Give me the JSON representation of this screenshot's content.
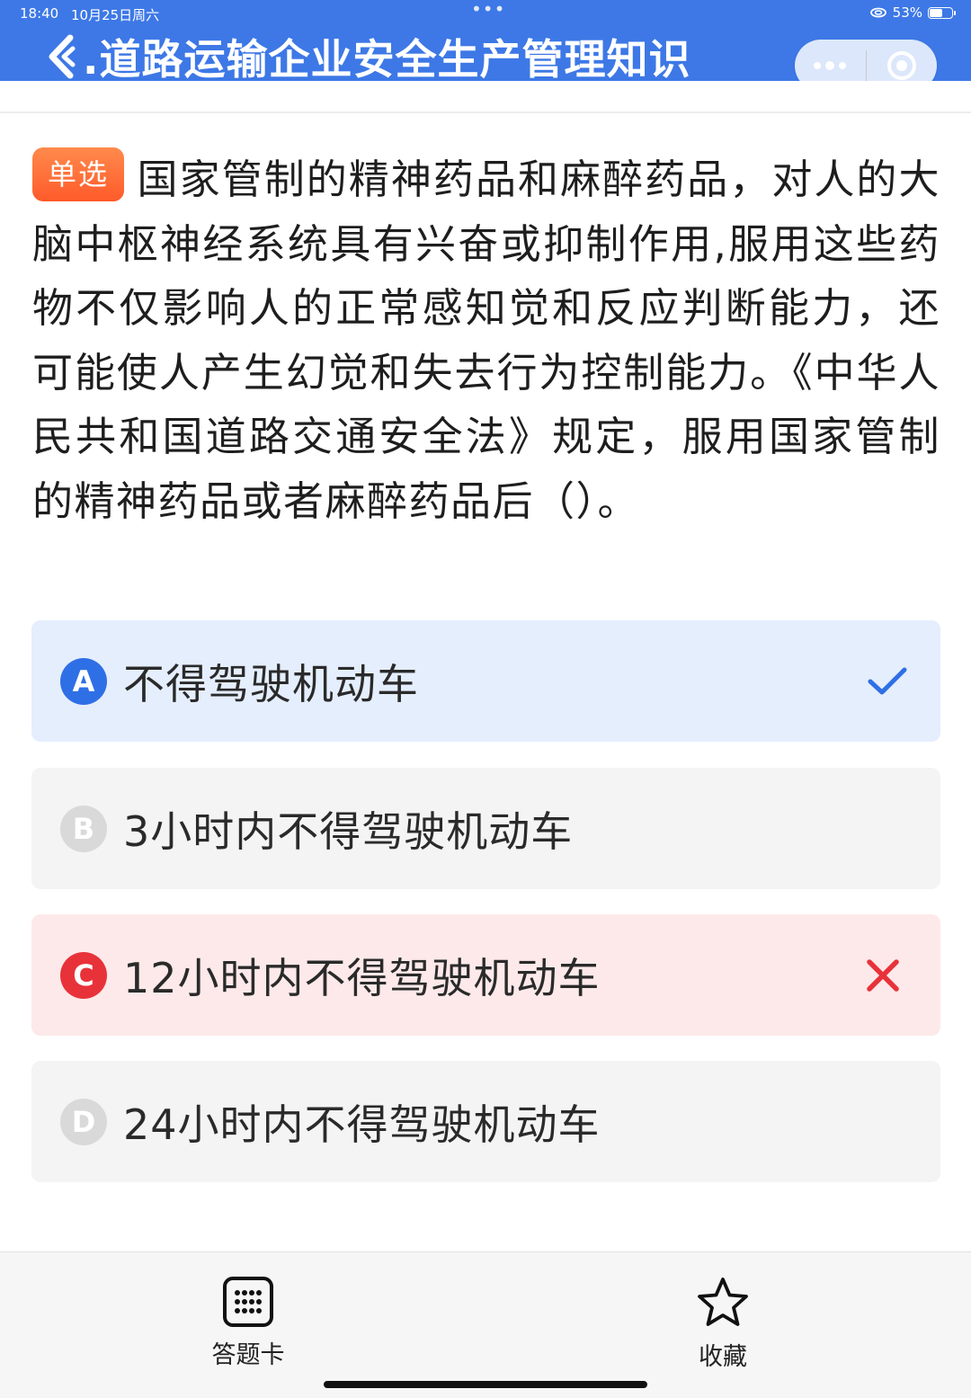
{
  "status_bar": {
    "time": "18:40",
    "date": "10月25日周六",
    "center_dots": "•••",
    "battery": "53%"
  },
  "header": {
    "title": ".道路运输企业安全生产管理知识",
    "capsule_more_icon": "more-dots-icon",
    "capsule_close_icon": "target-circle-icon"
  },
  "question": {
    "type_label": "单选",
    "text": "国家管制的精神药品和麻醉药品，对人的大脑中枢神经系统具有兴奋或抑制作用,服用这些药物不仅影响人的正常感知觉和反应判断能力，还可能使人产生幻觉和失去行为控制能力。《中华人民共和国道路交通安全法》规定，服用国家管制的精神药品或者麻醉药品后（）。"
  },
  "options": [
    {
      "letter": "A",
      "text": "不得驾驶机动车",
      "state": "correct"
    },
    {
      "letter": "B",
      "text": "3小时内不得驾驶机动车",
      "state": "neutral"
    },
    {
      "letter": "C",
      "text": "12小时内不得驾驶机动车",
      "state": "wrong"
    },
    {
      "letter": "D",
      "text": "24小时内不得驾驶机动车",
      "state": "neutral"
    }
  ],
  "bottom_bar": {
    "answer_card_label": "答题卡",
    "favorite_label": "收藏"
  },
  "colors": {
    "header_bg": "#3d78e6",
    "correct_bg": "#e5eefd",
    "wrong_bg": "#fde9e9",
    "correct_accent": "#2f6fe6",
    "wrong_accent": "#e8323a",
    "badge": "#ff6a35"
  }
}
